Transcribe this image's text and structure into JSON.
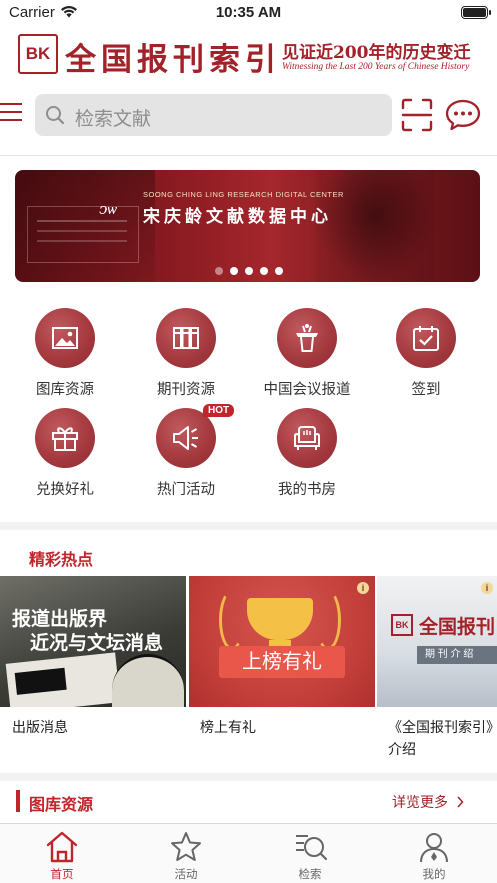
{
  "status_bar": {
    "carrier": "Carrier",
    "time": "10:35 AM"
  },
  "header": {
    "logo_text": "BK",
    "title": "全国报刊索引",
    "slogan": "见证近200年的历史变迁",
    "slogan_en": "Witnessing the Last 200 Years of Chinese History"
  },
  "search": {
    "placeholder": "检索文献"
  },
  "carousel": {
    "caption_en": "SOONG CHING LING RESEARCH DIGITAL CENTER",
    "caption_cn": "宋庆龄文献数据中心",
    "dot_count": 5,
    "active_dot": 0
  },
  "grid": [
    {
      "id": "gallery",
      "label": "图库资源",
      "icon": "image-icon"
    },
    {
      "id": "journals",
      "label": "期刊资源",
      "icon": "books-icon"
    },
    {
      "id": "conference",
      "label": "中国会议报道",
      "icon": "podium-icon"
    },
    {
      "id": "checkin",
      "label": "签到",
      "icon": "calendar-check-icon"
    },
    {
      "id": "redeem",
      "label": "兑换好礼",
      "icon": "gift-icon"
    },
    {
      "id": "events",
      "label": "热门活动",
      "icon": "megaphone-icon",
      "badge": "HOT"
    },
    {
      "id": "study",
      "label": "我的书房",
      "icon": "armchair-icon"
    }
  ],
  "highlights": {
    "title": "精彩热点",
    "cards": [
      {
        "caption": "出版消息",
        "image_text_1": "报道出版界",
        "image_text_2": "近况与文坛消息"
      },
      {
        "caption": "榜上有礼",
        "image_text": "上榜有礼"
      },
      {
        "caption": "《全国报刊索引》介绍",
        "image_text": "全国报刊",
        "image_band": "期 刊 介 绍"
      }
    ]
  },
  "gallery_section": {
    "title": "图库资源",
    "more_label": "详览更多"
  },
  "tabs": [
    {
      "label": "首页",
      "icon": "home-icon",
      "active": true
    },
    {
      "label": "活动",
      "icon": "star-icon",
      "active": false
    },
    {
      "label": "检索",
      "icon": "search-list-icon",
      "active": false
    },
    {
      "label": "我的",
      "icon": "user-icon",
      "active": false
    }
  ],
  "colors": {
    "brand": "#a3222a",
    "accent": "#c0252b"
  }
}
